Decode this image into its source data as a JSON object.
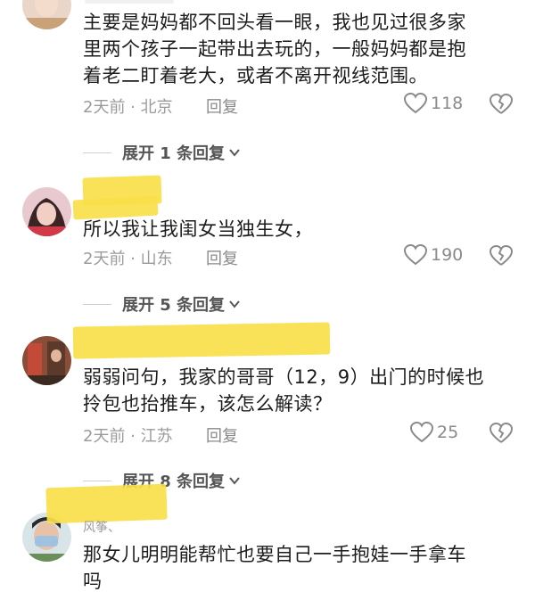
{
  "comments": [
    {
      "text_lines": [
        "主要是妈妈都不回头看一眼，我也见过很多家",
        "里两个孩子一起带出去玩的，一般妈妈都是抱",
        "着老二盯着老大，或者不离开视线范围。"
      ],
      "time_location": "2天前 · 北京",
      "reply_label": "回复",
      "likes": "118",
      "expand_label": "展开 1 条回复"
    },
    {
      "text_lines": [
        "所以我让我闺女当独生女，"
      ],
      "time_location": "2天前 · 山东",
      "reply_label": "回复",
      "likes": "190",
      "expand_label": "展开 5 条回复"
    },
    {
      "text_lines": [
        "弱弱问句，我家的哥哥（12，9）出门的时候也",
        "拎包也抬推车，该怎么解读？"
      ],
      "time_location": "2天前 · 江苏",
      "reply_label": "回复",
      "likes": "25",
      "expand_label": "展开 8 条回复"
    },
    {
      "username": "风筝、",
      "text_lines": [
        "那女儿明明能帮忙也要自己一手抱娃一手拿车",
        "吗"
      ]
    }
  ],
  "colors": {
    "highlight": "#f8e04a",
    "meta_text": "#9b9b9b",
    "body_text": "#1c1c1c"
  }
}
